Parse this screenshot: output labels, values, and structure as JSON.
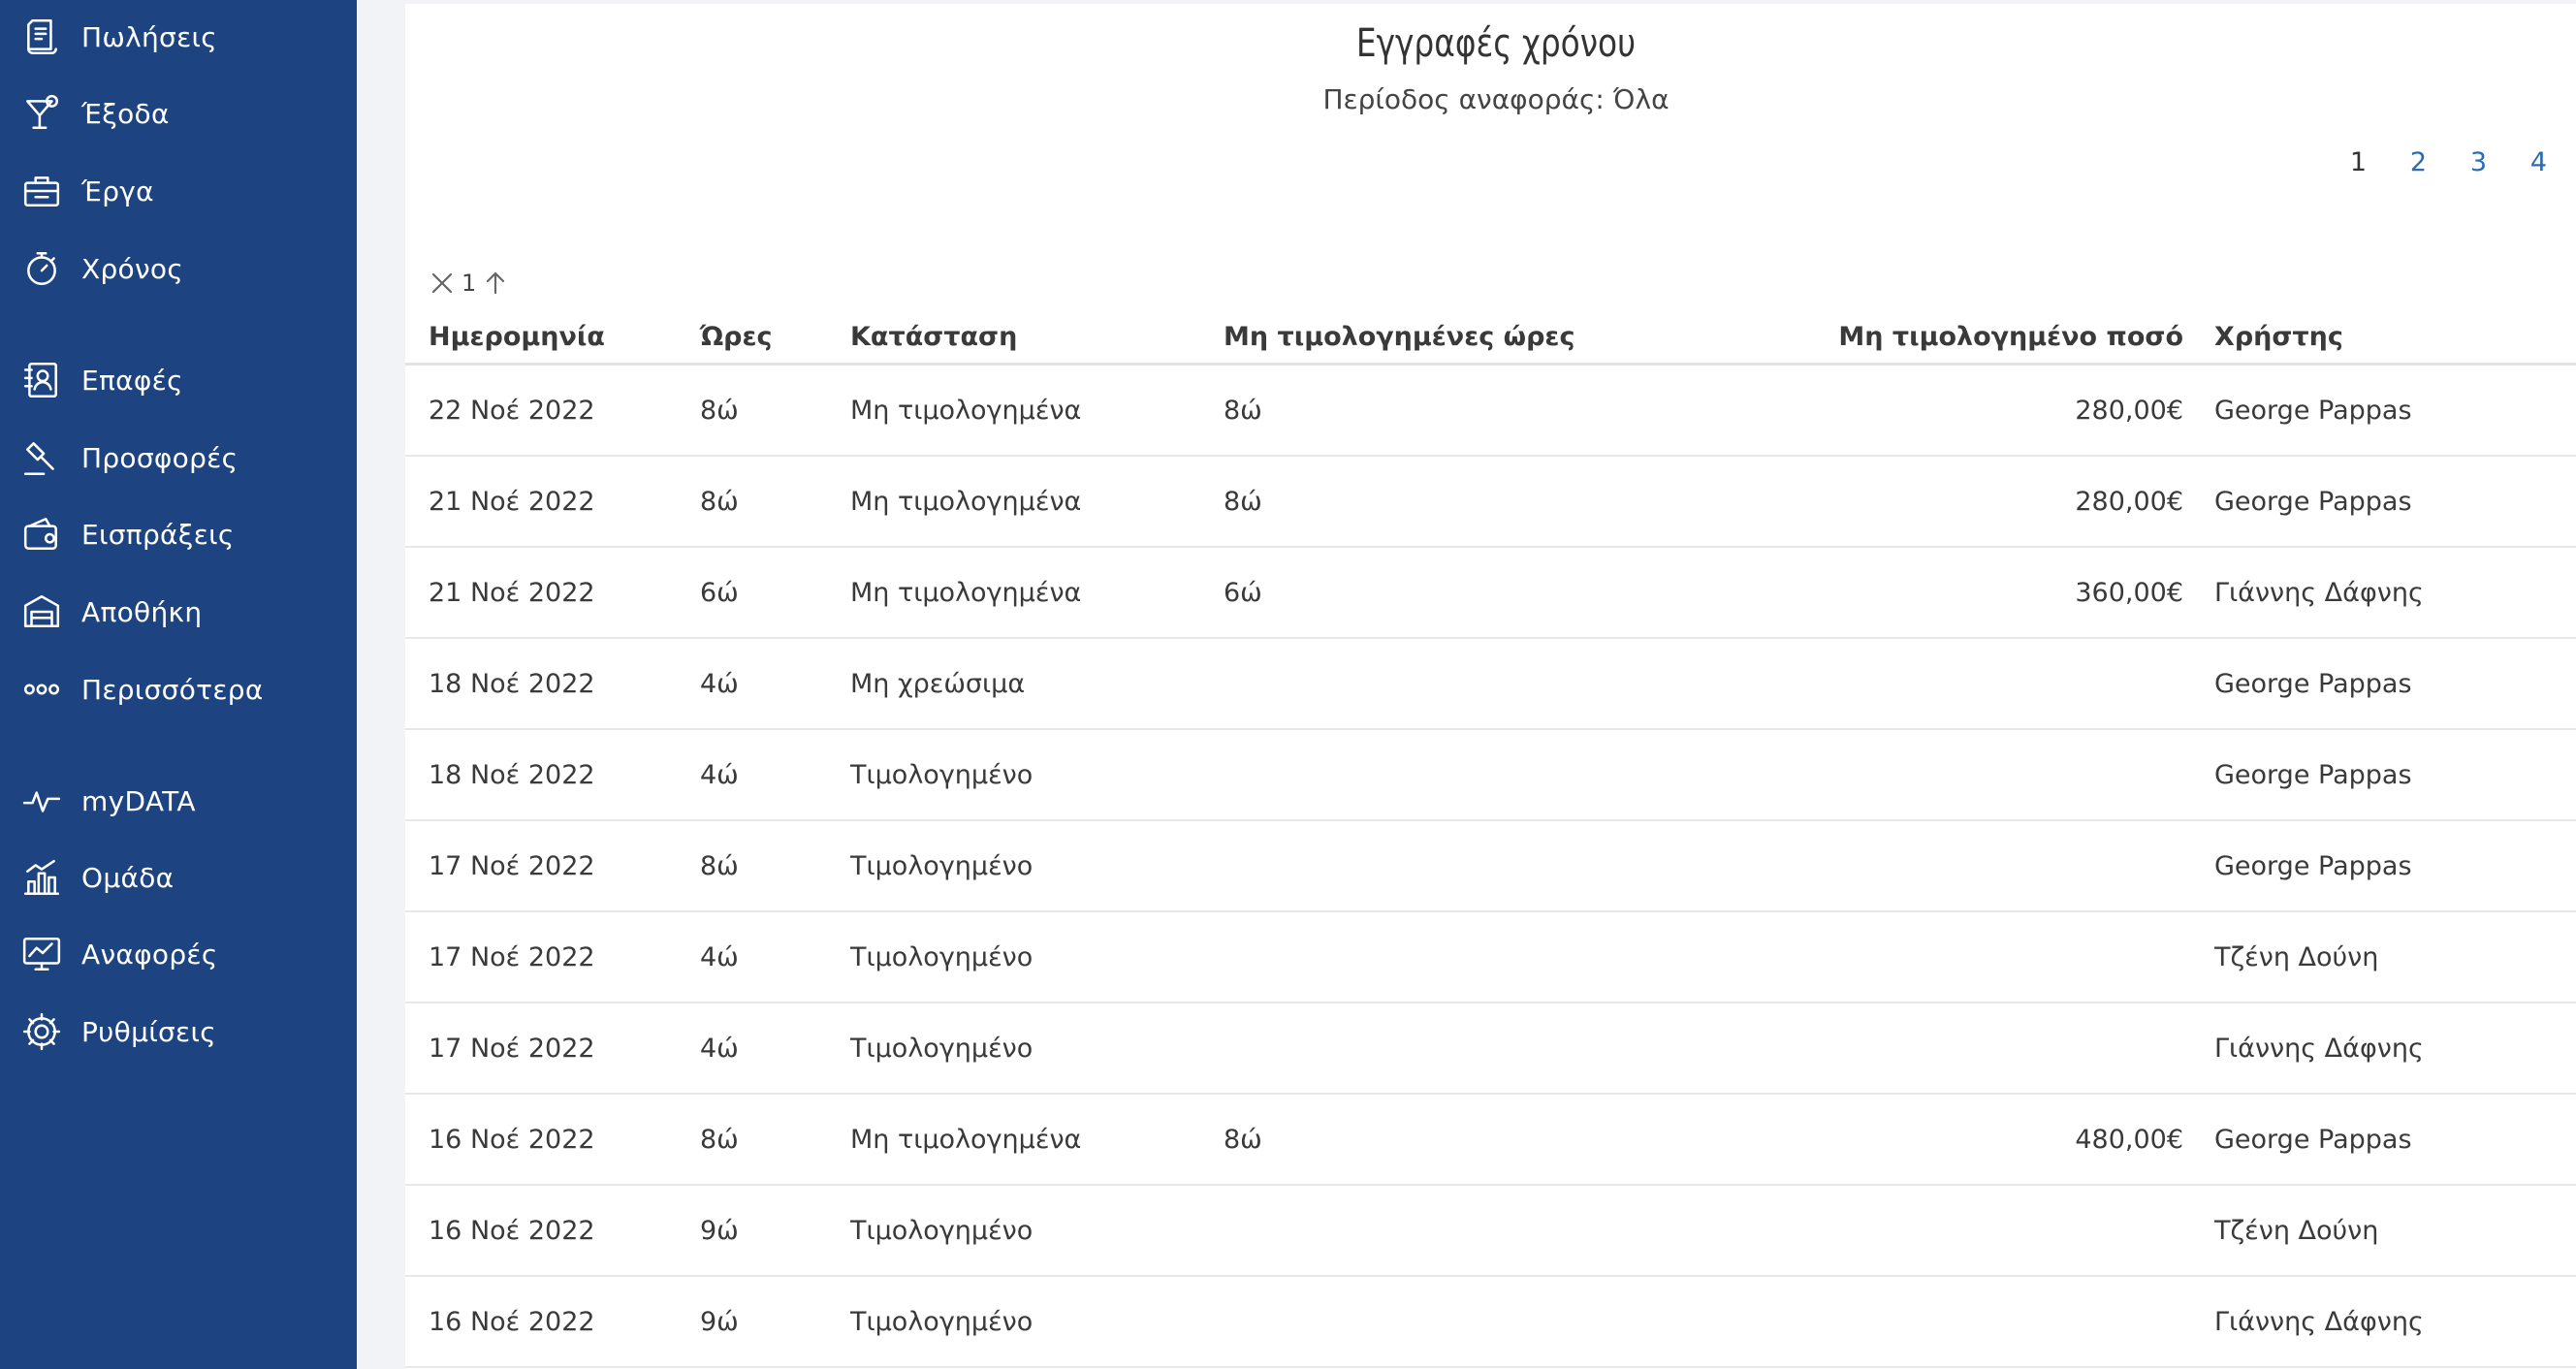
{
  "sidebar": {
    "items": [
      {
        "label": "Πωλήσεις",
        "icon": "invoice-icon"
      },
      {
        "label": "Έξοδα",
        "icon": "cocktail-icon"
      },
      {
        "label": "Έργα",
        "icon": "briefcase-icon"
      },
      {
        "label": "Χρόνος",
        "icon": "stopwatch-icon"
      },
      {
        "label": "Επαφές",
        "icon": "contacts-icon"
      },
      {
        "label": "Προσφορές",
        "icon": "gavel-icon"
      },
      {
        "label": "Εισπράξεις",
        "icon": "wallet-icon"
      },
      {
        "label": "Αποθήκη",
        "icon": "warehouse-icon"
      },
      {
        "label": "Περισσότερα",
        "icon": "more-dots-icon"
      },
      {
        "label": "myDATA",
        "icon": "pulse-icon"
      },
      {
        "label": "Ομάδα",
        "icon": "team-chart-icon"
      },
      {
        "label": "Αναφορές",
        "icon": "monitor-chart-icon"
      },
      {
        "label": "Ρυθμίσεις",
        "icon": "gear-icon"
      }
    ]
  },
  "report": {
    "title": "Εγγραφές χρόνου",
    "subtitle": "Περίοδος αναφοράς: Όλα"
  },
  "pager": {
    "pages": [
      "1",
      "2",
      "3",
      "4"
    ],
    "current": "1"
  },
  "sort": {
    "count": "1"
  },
  "table": {
    "headers": {
      "date": "Ημερομηνία",
      "hours": "Ώρες",
      "status": "Κατάσταση",
      "unbilled_hours": "Μη τιμολογημένες ώρες",
      "unbilled_amount": "Μη τιμολογημένο ποσό",
      "user": "Χρήστης"
    },
    "rows": [
      {
        "date": "22 Νοέ 2022",
        "hours": "8ώ",
        "status": "Μη τιμολογημένα",
        "unbilled_hours": "8ώ",
        "unbilled_amount": "280,00€",
        "user": "George Pappas"
      },
      {
        "date": "21 Νοέ 2022",
        "hours": "8ώ",
        "status": "Μη τιμολογημένα",
        "unbilled_hours": "8ώ",
        "unbilled_amount": "280,00€",
        "user": "George Pappas"
      },
      {
        "date": "21 Νοέ 2022",
        "hours": "6ώ",
        "status": "Μη τιμολογημένα",
        "unbilled_hours": "6ώ",
        "unbilled_amount": "360,00€",
        "user": "Γιάννης Δάφνης"
      },
      {
        "date": "18 Νοέ 2022",
        "hours": "4ώ",
        "status": "Μη χρεώσιμα",
        "unbilled_hours": "",
        "unbilled_amount": "",
        "user": "George Pappas"
      },
      {
        "date": "18 Νοέ 2022",
        "hours": "4ώ",
        "status": "Τιμολογημένο",
        "unbilled_hours": "",
        "unbilled_amount": "",
        "user": "George Pappas"
      },
      {
        "date": "17 Νοέ 2022",
        "hours": "8ώ",
        "status": "Τιμολογημένο",
        "unbilled_hours": "",
        "unbilled_amount": "",
        "user": "George Pappas"
      },
      {
        "date": "17 Νοέ 2022",
        "hours": "4ώ",
        "status": "Τιμολογημένο",
        "unbilled_hours": "",
        "unbilled_amount": "",
        "user": "Τζένη Δούνη"
      },
      {
        "date": "17 Νοέ 2022",
        "hours": "4ώ",
        "status": "Τιμολογημένο",
        "unbilled_hours": "",
        "unbilled_amount": "",
        "user": "Γιάννης Δάφνης"
      },
      {
        "date": "16 Νοέ 2022",
        "hours": "8ώ",
        "status": "Μη τιμολογημένα",
        "unbilled_hours": "8ώ",
        "unbilled_amount": "480,00€",
        "user": "George Pappas"
      },
      {
        "date": "16 Νοέ 2022",
        "hours": "9ώ",
        "status": "Τιμολογημένο",
        "unbilled_hours": "",
        "unbilled_amount": "",
        "user": "Τζένη Δούνη"
      },
      {
        "date": "16 Νοέ 2022",
        "hours": "9ώ",
        "status": "Τιμολογημένο",
        "unbilled_hours": "",
        "unbilled_amount": "",
        "user": "Γιάννης Δάφνης"
      }
    ]
  }
}
